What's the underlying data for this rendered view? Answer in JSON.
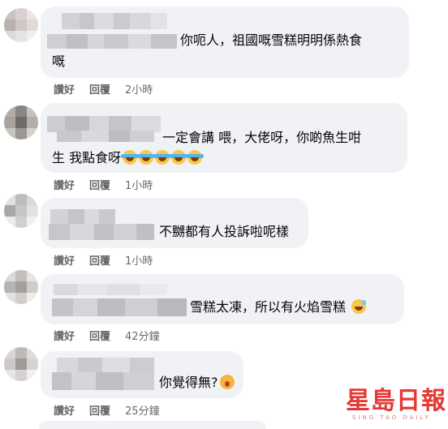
{
  "comments": [
    {
      "text_line1": "你呃人，祖國嘅雪糕明明係熱食",
      "text_line2": "嘅",
      "actions": {
        "like": "讚好",
        "reply": "回覆",
        "time": "2小時"
      }
    },
    {
      "text_line1": "一定會講 喂，大佬呀，你啲魚生咁",
      "text_line2": "生 我點食呀",
      "emoji": [
        "face-with-tears-of-joy-icon",
        "face-with-tears-of-joy-icon",
        "face-with-tears-of-joy-icon",
        "face-with-tears-of-joy-icon",
        "face-with-tears-of-joy-icon"
      ],
      "actions": {
        "like": "讚好",
        "reply": "回覆",
        "time": "1小時"
      }
    },
    {
      "text_line1": "不嬲都有人投訴啦呢樣",
      "actions": {
        "like": "讚好",
        "reply": "回覆",
        "time": "1小時"
      }
    },
    {
      "text_line1": "雪糕太凍，所以有火焰雪糕",
      "emoji": [
        "grinning-sweat-icon"
      ],
      "actions": {
        "like": "讚好",
        "reply": "回覆",
        "time": "42分鐘"
      }
    },
    {
      "text_line1": "你覺得無?",
      "emoji": [
        "astonished-face-icon"
      ],
      "actions": {
        "like": "讚好",
        "reply": "回覆",
        "time": "25分鐘"
      }
    }
  ],
  "watermark": {
    "name": "星島日報",
    "sub": "SING TAO DAILY"
  },
  "colors": {
    "bubble": "#f0f2f5",
    "action_text": "#65676b",
    "text": "#050505",
    "watermark": "#e53935"
  }
}
